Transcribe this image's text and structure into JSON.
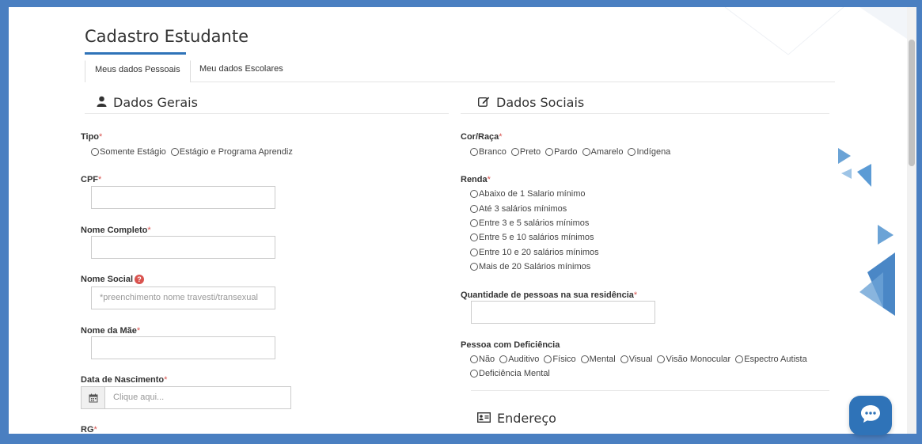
{
  "page": {
    "title": "Cadastro Estudante",
    "tabs": [
      {
        "label": "Meus dados Pessoais",
        "active": true
      },
      {
        "label": "Meu dados Escolares",
        "active": false
      }
    ]
  },
  "dados_gerais": {
    "heading": "Dados Gerais",
    "icon": "user-icon",
    "tipo": {
      "label": "Tipo",
      "required": "*",
      "options": [
        "Somente Estágio",
        "Estágio e Programa Aprendiz"
      ]
    },
    "cpf": {
      "label": "CPF",
      "required": "*",
      "value": "",
      "placeholder": ""
    },
    "nome_completo": {
      "label": "Nome Completo",
      "required": "*",
      "value": "",
      "placeholder": ""
    },
    "nome_social": {
      "label": "Nome Social",
      "help_icon": "?",
      "value": "",
      "placeholder": "*preenchimento nome travesti/transexual"
    },
    "nome_mae": {
      "label": "Nome da Mãe",
      "required": "*",
      "value": "",
      "placeholder": ""
    },
    "data_nascimento": {
      "label": "Data de Nascimento",
      "required": "*",
      "value": "",
      "placeholder": "Clique aqui..."
    },
    "rg": {
      "label": "RG",
      "required": "*"
    }
  },
  "dados_sociais": {
    "heading": "Dados Sociais",
    "icon": "edit-icon",
    "cor_raca": {
      "label": "Cor/Raça",
      "required": "*",
      "options": [
        "Branco",
        "Preto",
        "Pardo",
        "Amarelo",
        "Indígena"
      ]
    },
    "renda": {
      "label": "Renda",
      "required": "*",
      "options": [
        "Abaixo de 1 Salario mínimo",
        "Até 3 salários mínimos",
        "Entre 3 e 5 salários mínimos",
        "Entre 5 e 10 salários mínimos",
        "Entre 10 e 20 salários mínimos",
        "Mais de 20 Salários mínimos"
      ]
    },
    "qtd_pessoas": {
      "label": "Quantidade de pessoas na sua residência",
      "required": "*",
      "value": ""
    },
    "deficiencia": {
      "label": "Pessoa com Deficiência",
      "options": [
        "Não",
        "Auditivo",
        "Físico",
        "Mental",
        "Visual",
        "Visão Monocular",
        "Espectro Autista",
        "Deficiência Mental"
      ]
    }
  },
  "endereco": {
    "heading": "Endereço",
    "icon": "address-card-icon"
  },
  "chat": {
    "icon": "chat-icon"
  },
  "colors": {
    "frame": "#4a7fc1",
    "accent": "#2f73b8",
    "required": "#d9534f"
  }
}
